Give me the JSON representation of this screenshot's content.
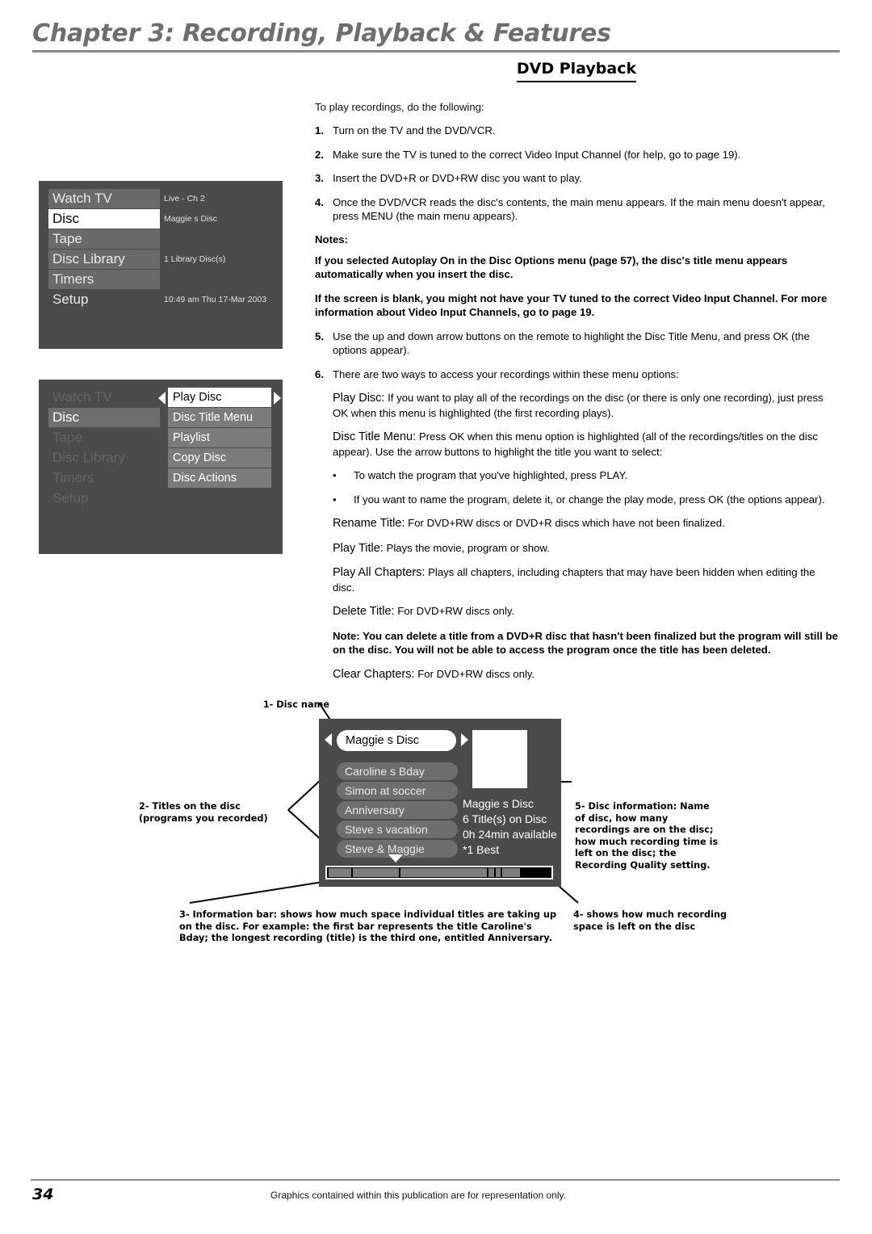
{
  "header": {
    "chapter_title": "Chapter 3: Recording, Playback & Features"
  },
  "section": {
    "title": "DVD Playback",
    "intro": "To play recordings, do the following:"
  },
  "steps": [
    {
      "num": "1.",
      "text": "Turn on the TV and the DVD/VCR."
    },
    {
      "num": "2.",
      "text": "Make sure the TV is tuned to the correct Video Input Channel (for help, go to page 19)."
    },
    {
      "num": "3.",
      "text": "Insert the DVD+R or DVD+RW disc you want to play."
    },
    {
      "num": "4.",
      "text": "Once the DVD/VCR reads the disc's contents, the main menu appears. If the main menu doesn't appear, press MENU (the main menu appears)."
    }
  ],
  "notes": {
    "label": "Notes:",
    "note_1": "If you selected Autoplay On in the Disc Options menu (page 57), the disc's title menu appears automatically when you insert the disc.",
    "note_2": "If the screen is blank, you might not have your TV tuned to the correct Video Input Channel. For more information about Video Input Channels, go to page 19."
  },
  "steps2": [
    {
      "num": "5.",
      "term": "",
      "text": "Use the up and down arrow buttons on the remote to highlight the Disc Title Menu, and press OK (the options appear)."
    },
    {
      "num": "6.",
      "term": "",
      "text": "There are two ways to access your recordings within these menu options:"
    }
  ],
  "definitions": [
    {
      "term": "Play Disc:",
      "text": " If you want to play all of the recordings on the disc (or there is only one recording), just press OK when this menu is highlighted (the first recording plays)."
    },
    {
      "term": "Disc Title Menu:",
      "text": " Press OK when this menu option is highlighted (all of the recordings/titles on the disc appear). Use the arrow buttons to highlight the title you want to select:"
    }
  ],
  "bullets": [
    {
      "dot": "•",
      "text": "To watch the program that you've highlighted, press PLAY."
    },
    {
      "dot": "•",
      "text": "If you want to name the program, delete it, or change the play mode, press OK (the options appear)."
    }
  ],
  "definitions2": [
    {
      "term": "Rename Title:",
      "text": " For DVD+RW discs or DVD+R discs which have not been finalized."
    },
    {
      "term": "Play Title:",
      "text": " Plays the movie, program or show."
    },
    {
      "term": "Play All Chapters:",
      "text": " Plays all chapters, including chapters that may have been hidden when editing the disc."
    },
    {
      "term": "Delete Title:",
      "text": " For DVD+RW discs only."
    }
  ],
  "delete_note": "Note: You can delete a title from a DVD+R disc that hasn't been finalized but the program will still be on the disc. You will not be able to access the program once the title has been deleted.",
  "definitions3": [
    {
      "term": "Clear Chapters:",
      "text": " For DVD+RW discs only."
    }
  ],
  "tv_screen_1": {
    "menu": [
      {
        "label": "Watch TV",
        "style": "gray",
        "status": "Live - Ch 2"
      },
      {
        "label": "Disc",
        "style": "selected",
        "status": "Maggie s Disc"
      },
      {
        "label": "Tape",
        "style": "gray",
        "status": ""
      },
      {
        "label": "Disc Library",
        "style": "gray",
        "status": "1 Library Disc(s)"
      },
      {
        "label": "Timers",
        "style": "gray",
        "status": ""
      },
      {
        "label": "Setup",
        "style": "plain",
        "status": "10:49 am Thu 17-Mar 2003"
      }
    ]
  },
  "tv_screen_2": {
    "menu": [
      {
        "label": "Watch TV",
        "style": "dim"
      },
      {
        "label": "Disc",
        "style": "gray-selected"
      },
      {
        "label": "Tape",
        "style": "dim"
      },
      {
        "label": "Disc Library",
        "style": "dim"
      },
      {
        "label": "Timers",
        "style": "dim"
      },
      {
        "label": "Setup",
        "style": "dim"
      }
    ],
    "submenu": [
      {
        "label": "Play Disc",
        "style": "selected"
      },
      {
        "label": "Disc Title Menu",
        "style": "gray"
      },
      {
        "label": "Playlist",
        "style": "gray"
      },
      {
        "label": "Copy Disc",
        "style": "gray"
      },
      {
        "label": "Disc Actions",
        "style": "gray"
      }
    ]
  },
  "diagram": {
    "disc_name": "Maggie s Disc",
    "titles": [
      "Caroline s Bday",
      "Simon at soccer",
      "Anniversary",
      "Steve s vacation",
      "Steve & Maggie"
    ],
    "info_lines": [
      "Maggie s Disc",
      "6 Title(s) on Disc",
      "0h 24min available",
      "*1 Best"
    ],
    "info_bar_segments": [
      28,
      57,
      107,
      7,
      6,
      22
    ]
  },
  "callouts": {
    "c1": "1- Disc name",
    "c2": "2- Titles on the disc (programs you recorded)",
    "c3": "3- Information bar: shows how much space individual titles are taking up on the disc. For example: the first bar represents the title Caroline's Bday; the longest recording (title) is the third one, entitled Anniversary.",
    "c4": "4- shows how much recording space is left on the disc",
    "c5": "5- Disc information: Name of disc, how many recordings are on the disc; how much recording time is left on the disc; the Recording Quality setting."
  },
  "footer": {
    "page_number": "34",
    "note": "Graphics contained within this publication are for representation only."
  },
  "colors": {
    "screen_bg": "#4b4b4b",
    "menu_item_bg": "#6a6a6a",
    "rule_gray": "#8a8a8a",
    "title_gray": "#6e6e6e"
  }
}
